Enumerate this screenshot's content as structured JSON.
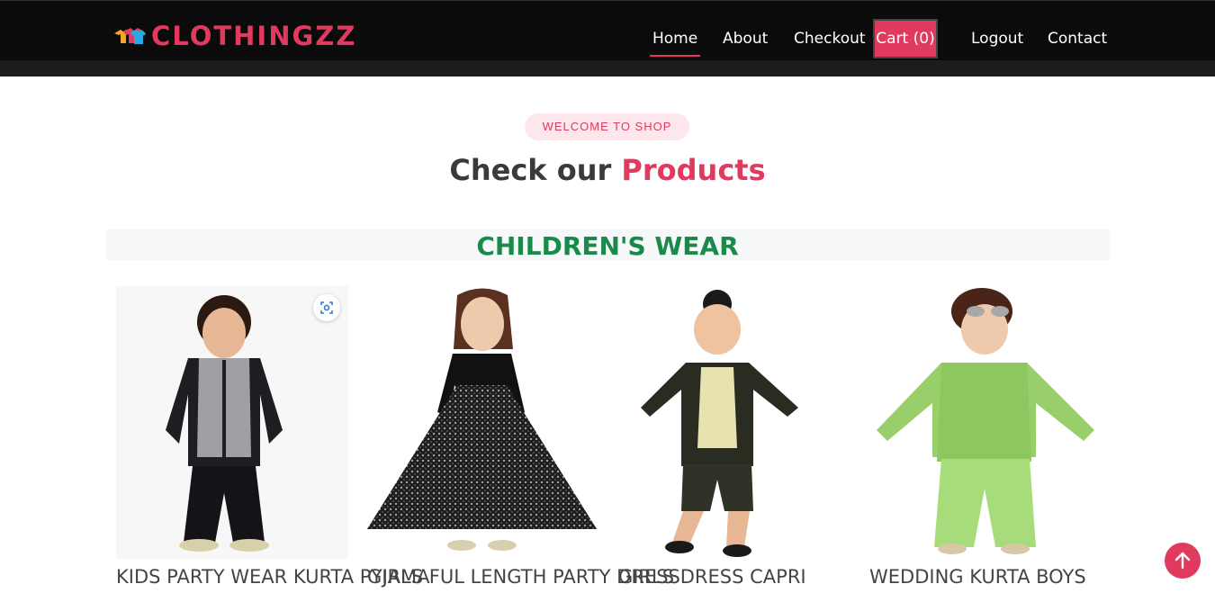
{
  "brand": {
    "name": "CLOTHINGZZ",
    "accent_color": "#e03a5e"
  },
  "nav": {
    "items": [
      {
        "label": "Home",
        "active": true
      },
      {
        "label": "About"
      },
      {
        "label": "Checkout"
      },
      {
        "label": "Cart (0)",
        "is_cart": true
      },
      {
        "label": "Logout"
      },
      {
        "label": "Contact"
      }
    ]
  },
  "hero": {
    "badge": "WELCOME TO SHOP",
    "title_prefix": "Check our",
    "title_accent": "Products"
  },
  "section": {
    "title": "CHILDREN'S WEAR",
    "title_color": "#1a8a4a"
  },
  "products": [
    {
      "name": "KIDS PARTY WEAR KURTA PYJAMA"
    },
    {
      "name": "GIRLS FUL LENGTH PARTY DRESS"
    },
    {
      "name": "GIRLS DRESS CAPRI"
    },
    {
      "name": "WEDDING KURTA BOYS"
    }
  ],
  "icons": {
    "zoom": "focus-zoom-icon",
    "scroll_top": "arrow-up-icon"
  }
}
